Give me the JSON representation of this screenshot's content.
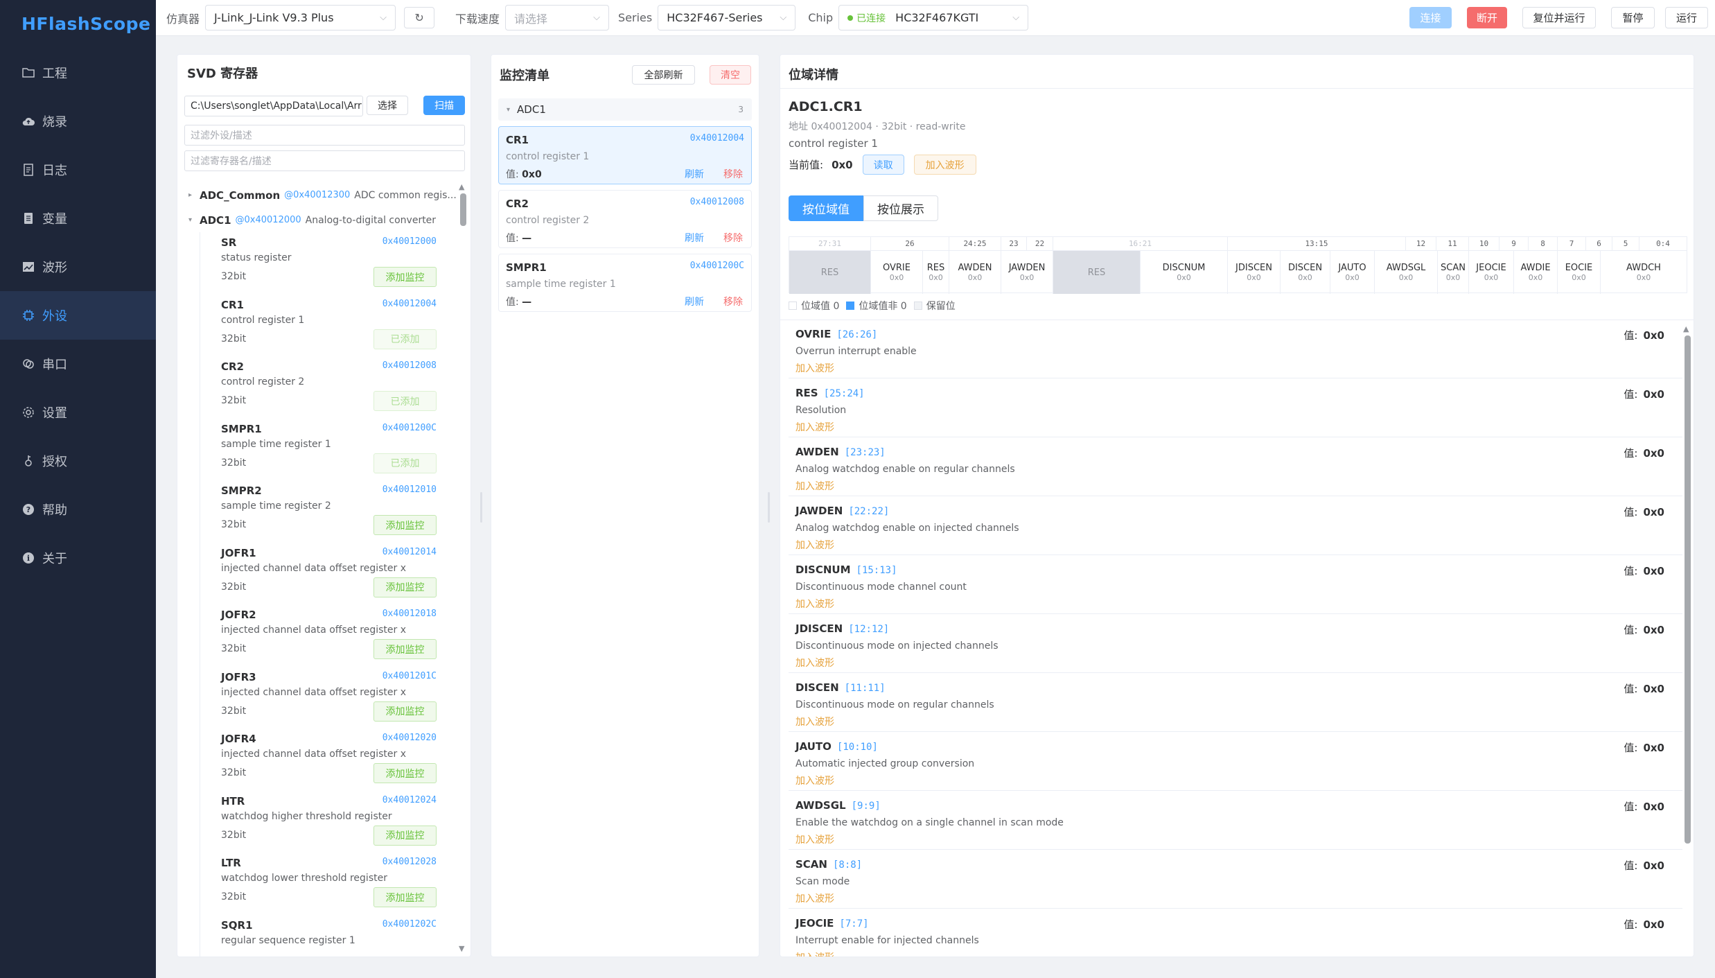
{
  "app": {
    "name": "HFlashScope"
  },
  "nav": [
    {
      "label": "工程",
      "icon": "folder-icon"
    },
    {
      "label": "烧录",
      "icon": "cloud-upload-icon"
    },
    {
      "label": "日志",
      "icon": "document-icon"
    },
    {
      "label": "变量",
      "icon": "variable-icon"
    },
    {
      "label": "波形",
      "icon": "chart-icon"
    },
    {
      "label": "外设",
      "icon": "chip-icon"
    },
    {
      "label": "串口",
      "icon": "link-icon"
    },
    {
      "label": "设置",
      "icon": "gear-icon"
    },
    {
      "label": "授权",
      "icon": "key-icon"
    },
    {
      "label": "帮助",
      "icon": "help-icon"
    },
    {
      "label": "关于",
      "icon": "info-icon"
    }
  ],
  "topbar": {
    "emulator_label": "仿真器",
    "emulator_value": "J-Link_J-Link V9.3 Plus",
    "speed_label": "下载速度",
    "speed_placeholder": "请选择",
    "series_label": "Series",
    "series_value": "HC32F467-Series",
    "chip_label": "Chip",
    "chip_status": "已连接",
    "chip_value": "HC32F467KGTI",
    "connect": "连接",
    "disconnect": "断开",
    "reset_run": "复位并运行",
    "pause": "暂停",
    "run": "运行"
  },
  "svd": {
    "title": "SVD 寄存器",
    "path": "C:\\Users\\songlet\\AppData\\Local\\Arr",
    "choose": "选择",
    "scan": "扫描",
    "filter_periph_placeholder": "过滤外设/描述",
    "filter_reg_placeholder": "过滤寄存器名/描述",
    "peripherals": [
      {
        "name": "ADC_Common",
        "addr": "@0x40012300",
        "desc": "ADC common regis..."
      },
      {
        "name": "ADC1",
        "addr": "@0x40012000",
        "desc": "Analog-to-digital converter"
      }
    ],
    "registers": [
      {
        "name": "SR",
        "addr": "0x40012000",
        "desc": "status register",
        "bits": "32bit",
        "action": "添加监控",
        "added": false
      },
      {
        "name": "CR1",
        "addr": "0x40012004",
        "desc": "control register 1",
        "bits": "32bit",
        "action": "已添加",
        "added": true
      },
      {
        "name": "CR2",
        "addr": "0x40012008",
        "desc": "control register 2",
        "bits": "32bit",
        "action": "已添加",
        "added": true
      },
      {
        "name": "SMPR1",
        "addr": "0x4001200C",
        "desc": "sample time register 1",
        "bits": "32bit",
        "action": "已添加",
        "added": true
      },
      {
        "name": "SMPR2",
        "addr": "0x40012010",
        "desc": "sample time register 2",
        "bits": "32bit",
        "action": "添加监控",
        "added": false
      },
      {
        "name": "JOFR1",
        "addr": "0x40012014",
        "desc": "injected channel data offset register x",
        "bits": "32bit",
        "action": "添加监控",
        "added": false
      },
      {
        "name": "JOFR2",
        "addr": "0x40012018",
        "desc": "injected channel data offset register x",
        "bits": "32bit",
        "action": "添加监控",
        "added": false
      },
      {
        "name": "JOFR3",
        "addr": "0x4001201C",
        "desc": "injected channel data offset register x",
        "bits": "32bit",
        "action": "添加监控",
        "added": false
      },
      {
        "name": "JOFR4",
        "addr": "0x40012020",
        "desc": "injected channel data offset register x",
        "bits": "32bit",
        "action": "添加监控",
        "added": false
      },
      {
        "name": "HTR",
        "addr": "0x40012024",
        "desc": "watchdog higher threshold register",
        "bits": "32bit",
        "action": "添加监控",
        "added": false
      },
      {
        "name": "LTR",
        "addr": "0x40012028",
        "desc": "watchdog lower threshold register",
        "bits": "32bit",
        "action": "添加监控",
        "added": false
      },
      {
        "name": "SQR1",
        "addr": "0x4001202C",
        "desc": "regular sequence register 1",
        "bits": "",
        "action": "",
        "added": false
      }
    ]
  },
  "monitor": {
    "title": "监控清单",
    "refresh_all": "全部刷新",
    "clear": "清空",
    "group": {
      "name": "ADC1",
      "count": "3"
    },
    "value_label": "值:",
    "items": [
      {
        "name": "CR1",
        "addr": "0x40012004",
        "desc": "control register 1",
        "value": "0x0",
        "refresh": "刷新",
        "remove": "移除"
      },
      {
        "name": "CR2",
        "addr": "0x40012008",
        "desc": "control register 2",
        "value": "—",
        "refresh": "刷新",
        "remove": "移除"
      },
      {
        "name": "SMPR1",
        "addr": "0x4001200C",
        "desc": "sample time register 1",
        "value": "—",
        "refresh": "刷新",
        "remove": "移除"
      }
    ]
  },
  "detail": {
    "title": "位域详情",
    "reg_name": "ADC1.CR1",
    "meta": "地址 0x40012004 · 32bit · read-write",
    "desc": "control register 1",
    "current_label": "当前值:",
    "current_value": "0x0",
    "read": "读取",
    "add_wave": "加入波形",
    "tab_bits": "按位域值",
    "tab_show": "按位展示",
    "bit_numbers": [
      "27:31",
      "26",
      "24:25",
      "23",
      "22",
      "16:21",
      "13:15",
      "12",
      "11",
      "10",
      "9",
      "8",
      "7",
      "6",
      "5",
      "0:4"
    ],
    "bitfields": [
      {
        "name": "RES",
        "value": "",
        "res": true
      },
      {
        "name": "OVRIE",
        "value": "0x0",
        "res": false
      },
      {
        "name": "RES",
        "value": "0x0",
        "res": false
      },
      {
        "name": "AWDEN",
        "value": "0x0",
        "res": false
      },
      {
        "name": "JAWDEN",
        "value": "0x0",
        "res": false
      },
      {
        "name": "RES",
        "value": "",
        "res": true
      },
      {
        "name": "DISCNUM",
        "value": "0x0",
        "res": false
      },
      {
        "name": "JDISCEN",
        "value": "0x0",
        "res": false
      },
      {
        "name": "DISCEN",
        "value": "0x0",
        "res": false
      },
      {
        "name": "JAUTO",
        "value": "0x0",
        "res": false
      },
      {
        "name": "AWDSGL",
        "value": "0x0",
        "res": false
      },
      {
        "name": "SCAN",
        "value": "0x0",
        "res": false
      },
      {
        "name": "JEOCIE",
        "value": "0x0",
        "res": false
      },
      {
        "name": "AWDIE",
        "value": "0x0",
        "res": false
      },
      {
        "name": "EOCIE",
        "value": "0x0",
        "res": false
      },
      {
        "name": "AWDCH",
        "value": "0x0",
        "res": false
      }
    ],
    "legend": [
      "位域值 0",
      "位域值非 0",
      "保留位"
    ],
    "value_label": "值:",
    "wave_link": "加入波形",
    "fields": [
      {
        "name": "OVRIE",
        "range": "[26:26]",
        "desc": "Overrun interrupt enable",
        "value": "0x0"
      },
      {
        "name": "RES",
        "range": "[25:24]",
        "desc": "Resolution",
        "value": "0x0"
      },
      {
        "name": "AWDEN",
        "range": "[23:23]",
        "desc": "Analog watchdog enable on regular channels",
        "value": "0x0"
      },
      {
        "name": "JAWDEN",
        "range": "[22:22]",
        "desc": "Analog watchdog enable on injected channels",
        "value": "0x0"
      },
      {
        "name": "DISCNUM",
        "range": "[15:13]",
        "desc": "Discontinuous mode channel count",
        "value": "0x0"
      },
      {
        "name": "JDISCEN",
        "range": "[12:12]",
        "desc": "Discontinuous mode on injected channels",
        "value": "0x0"
      },
      {
        "name": "DISCEN",
        "range": "[11:11]",
        "desc": "Discontinuous mode on regular channels",
        "value": "0x0"
      },
      {
        "name": "JAUTO",
        "range": "[10:10]",
        "desc": "Automatic injected group conversion",
        "value": "0x0"
      },
      {
        "name": "AWDSGL",
        "range": "[9:9]",
        "desc": "Enable the watchdog on a single channel in scan mode",
        "value": "0x0"
      },
      {
        "name": "SCAN",
        "range": "[8:8]",
        "desc": "Scan mode",
        "value": "0x0"
      },
      {
        "name": "JEOCIE",
        "range": "[7:7]",
        "desc": "Interrupt enable for injected channels",
        "value": "0x0"
      }
    ]
  },
  "colors": {
    "accent": "#409eff",
    "sidebar": "#1e2639",
    "success": "#67c23a",
    "danger": "#f56c6c",
    "warning": "#e6a23c"
  }
}
